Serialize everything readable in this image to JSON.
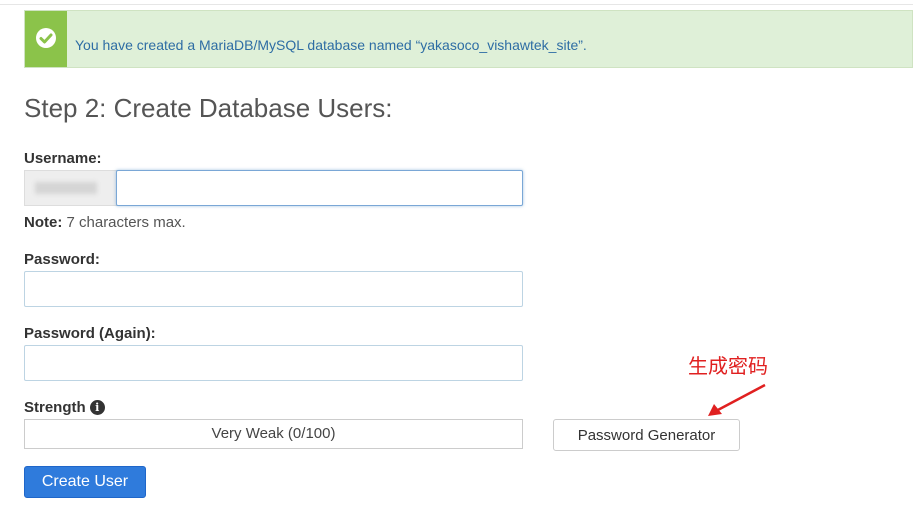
{
  "alert": {
    "message": "You have created a MariaDB/MySQL database named “yakasoco_vishawtek_site”.",
    "icon": "check-circle-icon",
    "colors": {
      "background": "#dff0d8",
      "icon_box": "#8bc34a",
      "text": "#2e6da4"
    }
  },
  "step": {
    "title": "Step 2: Create Database Users:"
  },
  "username": {
    "label": "Username:",
    "value": "",
    "note_bold": "Note:",
    "note_text": " 7 characters max."
  },
  "password": {
    "label": "Password:",
    "value": ""
  },
  "password_again": {
    "label": "Password (Again):",
    "value": ""
  },
  "strength": {
    "label": "Strength",
    "info_icon": "info-icon",
    "value_text": "Very Weak (0/100)",
    "score": 0
  },
  "buttons": {
    "password_generator": "Password Generator",
    "create_user": "Create User"
  },
  "annotation": {
    "text": "生成密码",
    "color": "#e02020"
  }
}
